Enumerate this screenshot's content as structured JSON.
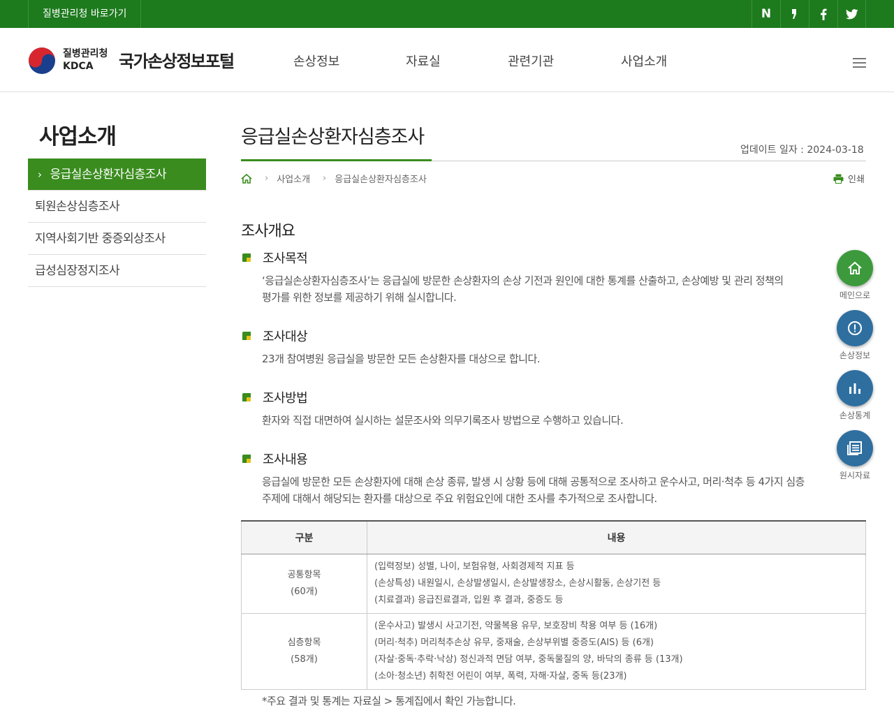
{
  "topbar": {
    "quick_link": "질병관리청 바로가기",
    "sns": [
      {
        "label": "N",
        "icon": "naver-blog-icon"
      },
      {
        "label": "❜",
        "icon": "kakao-story-icon"
      },
      {
        "label": "f",
        "icon": "facebook-icon"
      },
      {
        "label": "twitter",
        "icon": "twitter-icon"
      }
    ]
  },
  "header": {
    "org_name": "질병관리청",
    "org_abbr": "KDCA",
    "site_title": "국가손상정보포털",
    "nav": [
      "손상정보",
      "자료실",
      "관련기관",
      "사업소개"
    ]
  },
  "sidebar": {
    "title": "사업소개",
    "items": [
      {
        "label": "응급실손상환자심층조사",
        "active": true
      },
      {
        "label": "퇴원손상심층조사",
        "active": false
      },
      {
        "label": "지역사회기반 중증외상조사",
        "active": false
      },
      {
        "label": "급성심장정지조사",
        "active": false
      }
    ]
  },
  "content": {
    "page_title": "응급실손상환자심층조사",
    "update_date": "업데이트 일자 : 2024-03-18",
    "breadcrumb": [
      "사업소개",
      "응급실손상환자심층조사"
    ],
    "print_label": "인쇄",
    "section_title": "조사개요",
    "subsections": [
      {
        "title": "조사목적",
        "text": "‘응급실손상환자심층조사’는 응급실에 방문한 손상환자의 손상 기전과 원인에 대한 통계를 산출하고, 손상예방 및 관리 정책의\n평가를 위한 정보를 제공하기 위해 실시합니다."
      },
      {
        "title": "조사대상",
        "text": "23개 참여병원 응급실을 방문한 모든 손상환자를 대상으로 합니다."
      },
      {
        "title": "조사방법",
        "text": "환자와 직접 대면하여 실시하는 설문조사와 의무기록조사 방법으로 수행하고 있습니다."
      },
      {
        "title": "조사내용",
        "text": "응급실에 방문한 모든 손상환자에 대해 손상 종류, 발생 시 상황 등에 대해 공통적으로 조사하고 운수사고, 머리·척추 등 4가지 심층\n주제에 대해서 해당되는 환자를 대상으로 주요 위험요인에 대한 조사를 추가적으로 조사합니다."
      }
    ],
    "table": {
      "headers": [
        "구분",
        "내용"
      ],
      "rows": [
        {
          "category": "공통항목",
          "count": "(60개)",
          "items": [
            "(입력정보) 성별, 나이, 보험유형, 사회경제적 지표 등",
            "(손상특성) 내원일시, 손상발생일시, 손상발생장소, 손상시활동, 손상기전 등",
            "(치료결과) 응급진료결과, 입원 후 결과, 중증도 등"
          ]
        },
        {
          "category": "심층항목",
          "count": "(58개)",
          "items": [
            "(운수사고) 발생시 사고기전, 약물복용 유무, 보호장비 착용 여부 등 (16개)",
            "(머리·척추) 머리척추손상 유무, 중재술, 손상부위별 중증도(AIS) 등 (6개)",
            "(자살·중독·추락·낙상) 정신과적 면담 여부, 중독물질의 양, 바닥의 종류 등 (13개)",
            "(소아·청소년) 취학전 어린이 여부, 폭력, 자해·자살, 중독 등(23개)"
          ]
        }
      ]
    },
    "note": "*주요 결과 및 통계는 자료실 > 통계집에서 확인 가능합니다."
  },
  "quick_menu": [
    {
      "label": "메인으로",
      "icon": "home-icon",
      "color": "#3c9a3c"
    },
    {
      "label": "손상정보",
      "icon": "info-icon",
      "color": "#2f6fa0"
    },
    {
      "label": "손상통계",
      "icon": "bar-chart-icon",
      "color": "#2f6fa0"
    },
    {
      "label": "원시자료",
      "icon": "document-icon",
      "color": "#2f6fa0"
    }
  ]
}
